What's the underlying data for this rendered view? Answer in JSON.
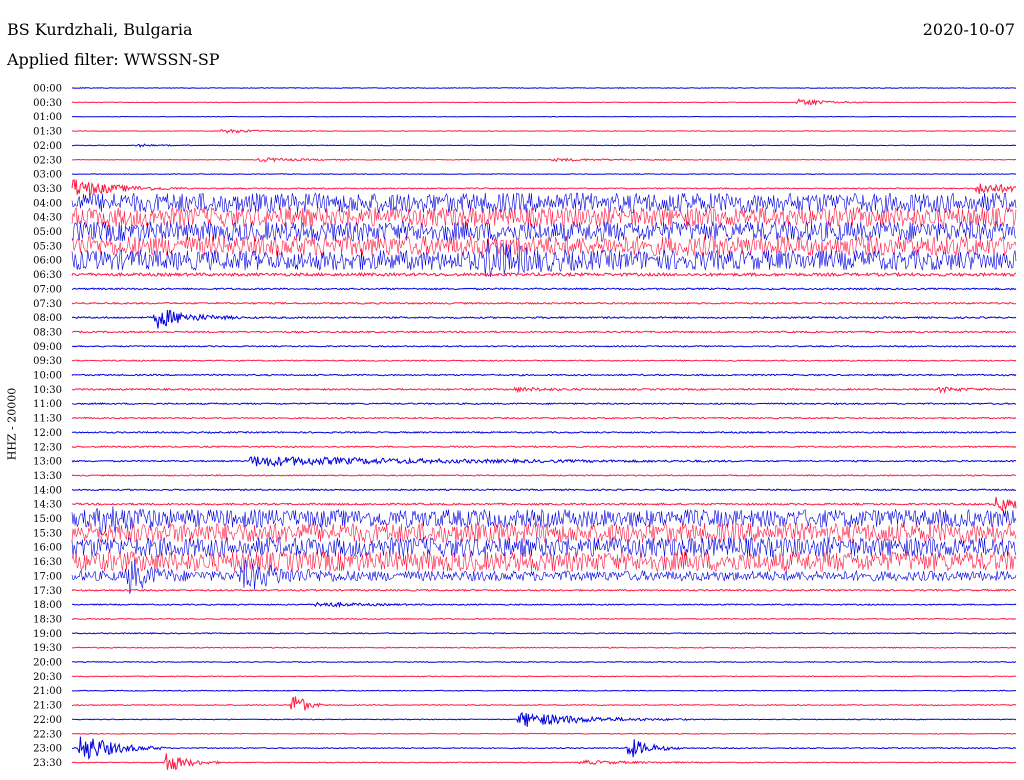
{
  "header": {
    "station": "BS Kurdzhali, Bulgaria",
    "date": "2020-10-07",
    "filter": "Applied filter: WWSSN-SP"
  },
  "chart_data": {
    "type": "line",
    "title": "BS Kurdzhali, Bulgaria",
    "subtitle": "Applied filter: WWSSN-SP",
    "date": "2020-10-07",
    "ylabel": "HHZ - 20000",
    "xlabel": "",
    "ticks": [
      "00:00",
      "00:30",
      "01:00",
      "01:30",
      "02:00",
      "02:30",
      "03:00",
      "03:30",
      "04:00",
      "04:30",
      "05:00",
      "05:30",
      "06:00",
      "06:30",
      "07:00",
      "07:30",
      "08:00",
      "08:30",
      "09:00",
      "09:30",
      "10:00",
      "10:30",
      "11:00",
      "11:30",
      "12:00",
      "12:30",
      "13:00",
      "13:30",
      "14:00",
      "14:30",
      "15:00",
      "15:30",
      "16:00",
      "16:30",
      "17:00",
      "17:30",
      "18:00",
      "18:30",
      "19:00",
      "19:30",
      "20:00",
      "20:30",
      "21:00",
      "21:30",
      "22:00",
      "22:30",
      "23:00",
      "23:30"
    ],
    "trace_minutes": 30,
    "colors": [
      "#0000e0",
      "#ff1a40"
    ],
    "grid": false,
    "legend": "none",
    "noise_level": [
      0.3,
      0.3,
      0.25,
      0.3,
      0.3,
      0.3,
      0.3,
      0.6,
      10,
      10,
      10,
      10,
      10,
      1.5,
      0.8,
      0.8,
      0.8,
      0.8,
      0.6,
      0.6,
      0.7,
      0.8,
      0.7,
      0.7,
      0.7,
      0.7,
      0.7,
      0.6,
      0.7,
      0.9,
      9,
      10,
      10,
      10,
      5,
      0.8,
      0.6,
      0.5,
      0.5,
      0.5,
      0.4,
      0.4,
      0.4,
      0.5,
      0.4,
      0.4,
      0.5,
      0.4
    ],
    "events": [
      {
        "trace": 1,
        "at": 0.77,
        "amp": 3,
        "dur": 0.03
      },
      {
        "trace": 3,
        "at": 0.16,
        "amp": 2,
        "dur": 0.03
      },
      {
        "trace": 4,
        "at": 0.07,
        "amp": 1.5,
        "dur": 0.02
      },
      {
        "trace": 5,
        "at": 0.2,
        "amp": 2,
        "dur": 0.04
      },
      {
        "trace": 5,
        "at": 0.51,
        "amp": 1.2,
        "dur": 0.06
      },
      {
        "trace": 7,
        "at": 0.96,
        "amp": 6,
        "dur": 0.04
      },
      {
        "trace": 7,
        "at": 0.0,
        "amp": 10,
        "dur": 0.04
      },
      {
        "trace": 12,
        "at": 0.44,
        "amp": 14,
        "dur": 0.03
      },
      {
        "trace": 16,
        "at": 0.09,
        "amp": 11,
        "dur": 0.03
      },
      {
        "trace": 21,
        "at": 0.47,
        "amp": 2,
        "dur": 0.03
      },
      {
        "trace": 21,
        "at": 0.92,
        "amp": 2.5,
        "dur": 0.02
      },
      {
        "trace": 26,
        "at": 0.19,
        "amp": 5,
        "dur": 0.17
      },
      {
        "trace": 29,
        "at": 0.98,
        "amp": 9,
        "dur": 0.02
      },
      {
        "trace": 30,
        "at": 0.03,
        "amp": 9,
        "dur": 0.03
      },
      {
        "trace": 34,
        "at": 0.06,
        "amp": 16,
        "dur": 0.02
      },
      {
        "trace": 34,
        "at": 0.18,
        "amp": 12,
        "dur": 0.04
      },
      {
        "trace": 36,
        "at": 0.26,
        "amp": 2.5,
        "dur": 0.04
      },
      {
        "trace": 43,
        "at": 0.235,
        "amp": 16,
        "dur": 0.01
      },
      {
        "trace": 44,
        "at": 0.475,
        "amp": 8,
        "dur": 0.06
      },
      {
        "trace": 46,
        "at": 0.01,
        "amp": 16,
        "dur": 0.03
      },
      {
        "trace": 46,
        "at": 0.59,
        "amp": 11,
        "dur": 0.02
      },
      {
        "trace": 47,
        "at": 0.1,
        "amp": 11,
        "dur": 0.02
      },
      {
        "trace": 47,
        "at": 0.54,
        "amp": 2,
        "dur": 0.05
      }
    ]
  }
}
